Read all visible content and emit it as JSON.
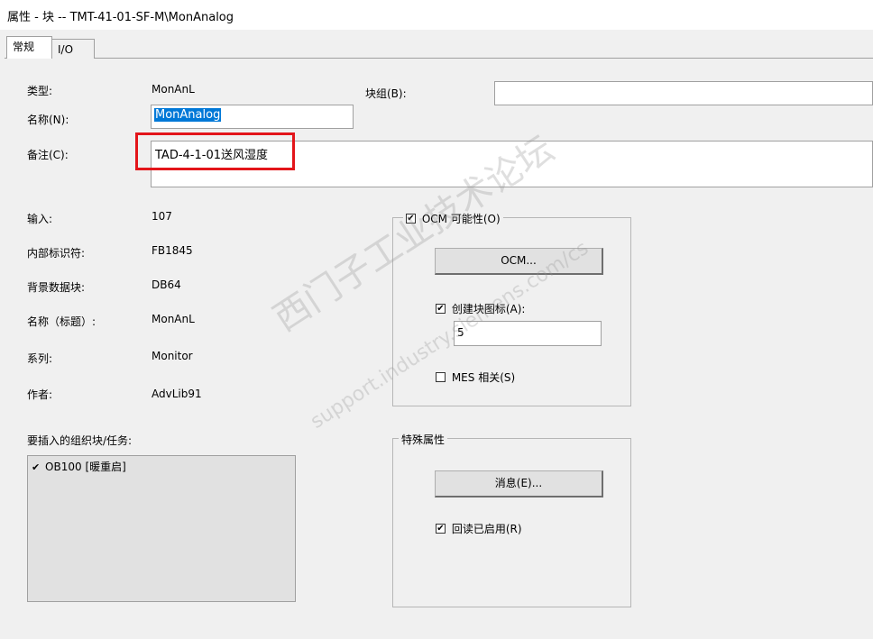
{
  "window": {
    "title": "属性 - 块 -- TMT-41-01-SF-M\\MonAnalog"
  },
  "tabs": [
    {
      "label": "常规"
    },
    {
      "label": "I/O"
    }
  ],
  "general": {
    "type_label": "类型:",
    "type_value": "MonAnL",
    "name_label": "名称(N):",
    "name_value": "MonAnalog",
    "block_group_label": "块组(B):",
    "block_group_value": "",
    "comment_label": "备注(C):",
    "comment_value": "TAD-4-1-01送风湿度",
    "input_label": "输入:",
    "input_value": "107",
    "internal_id_label": "内部标识符:",
    "internal_id_value": "FB1845",
    "instance_db_label": "背景数据块:",
    "instance_db_value": "DB64",
    "name_header_label": "名称（标题）:",
    "name_header_value": "MonAnL",
    "family_label": "系列:",
    "family_value": "Monitor",
    "author_label": "作者:",
    "author_value": "AdvLib91"
  },
  "insert_ob": {
    "label": "要插入的组织块/任务:",
    "items": [
      {
        "checked": true,
        "label": "OB100 [暖重启]"
      }
    ]
  },
  "ocm": {
    "checkbox_label": "OCM 可能性(O)",
    "checked": true,
    "button_label": "OCM...",
    "create_icon_label": "创建块图标(A):",
    "create_icon_checked": true,
    "icon_value": "5",
    "mes_label": "MES 相关(S)",
    "mes_checked": false
  },
  "special": {
    "group_label": "特殊属性",
    "message_button_label": "消息(E)...",
    "readback_label": "回读已启用(R)",
    "readback_checked": true
  },
  "watermark": {
    "text_cn": "西门子工业技术论坛",
    "text_url": "support.industry.siemens.com/cs"
  }
}
